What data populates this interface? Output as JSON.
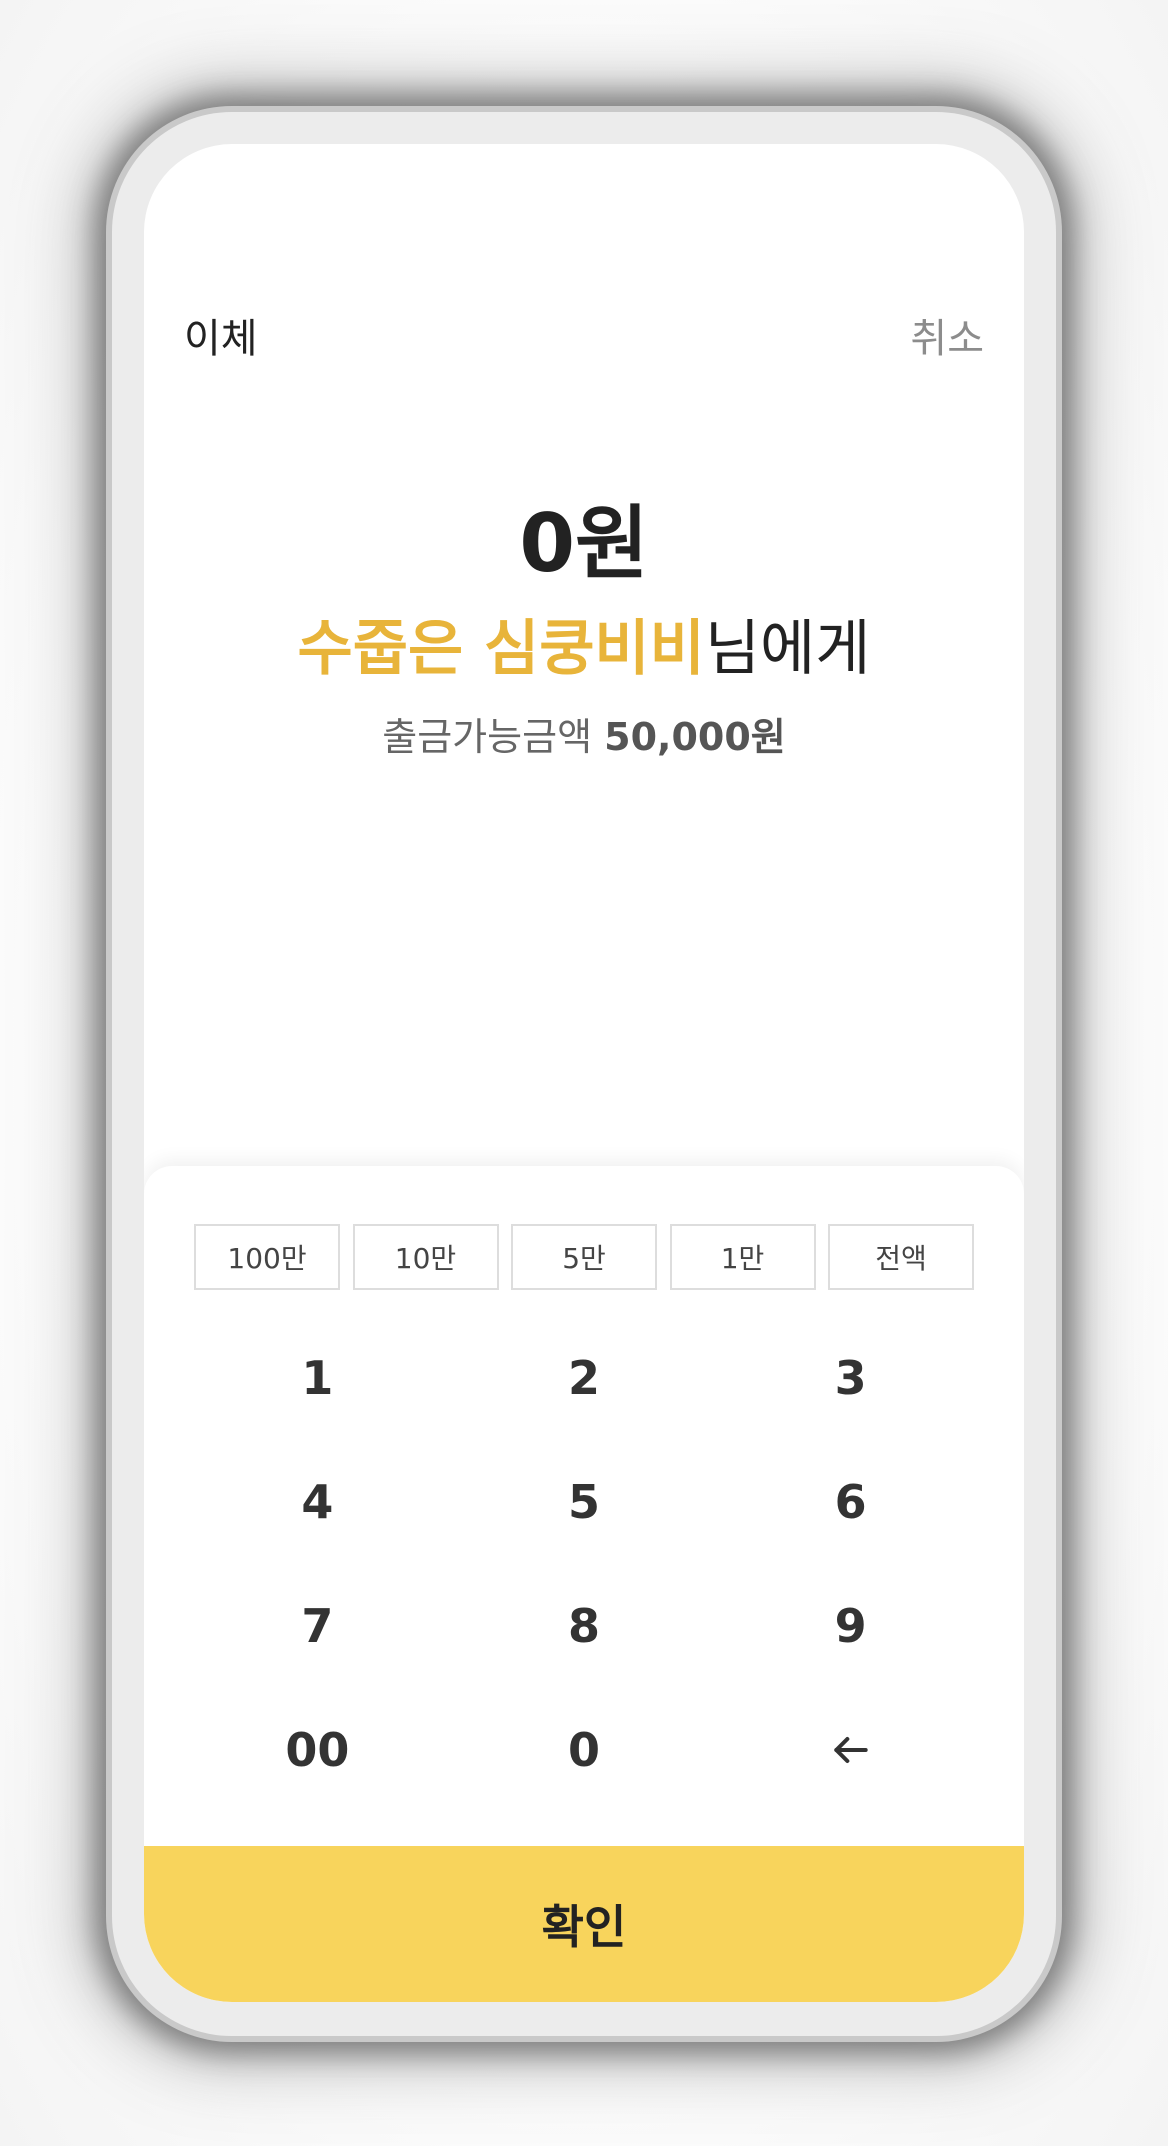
{
  "header": {
    "title": "이체",
    "cancel_label": "취소"
  },
  "amount": {
    "value_text": "0원"
  },
  "recipient": {
    "name": "수줍은 심쿵비비",
    "suffix": "님에게"
  },
  "balance": {
    "label": "출금가능금액",
    "value": "50,000원"
  },
  "quick_amounts": [
    "100만",
    "10만",
    "5만",
    "1만",
    "전액"
  ],
  "keypad": {
    "keys": [
      "1",
      "2",
      "3",
      "4",
      "5",
      "6",
      "7",
      "8",
      "9",
      "00",
      "0"
    ],
    "backspace_icon": "arrow-left-icon"
  },
  "confirm": {
    "label": "확인"
  },
  "colors": {
    "accent": "#e8b43a",
    "confirm_bg": "#f8d45c",
    "text_primary": "#222222",
    "text_secondary": "#8c8c8c"
  }
}
